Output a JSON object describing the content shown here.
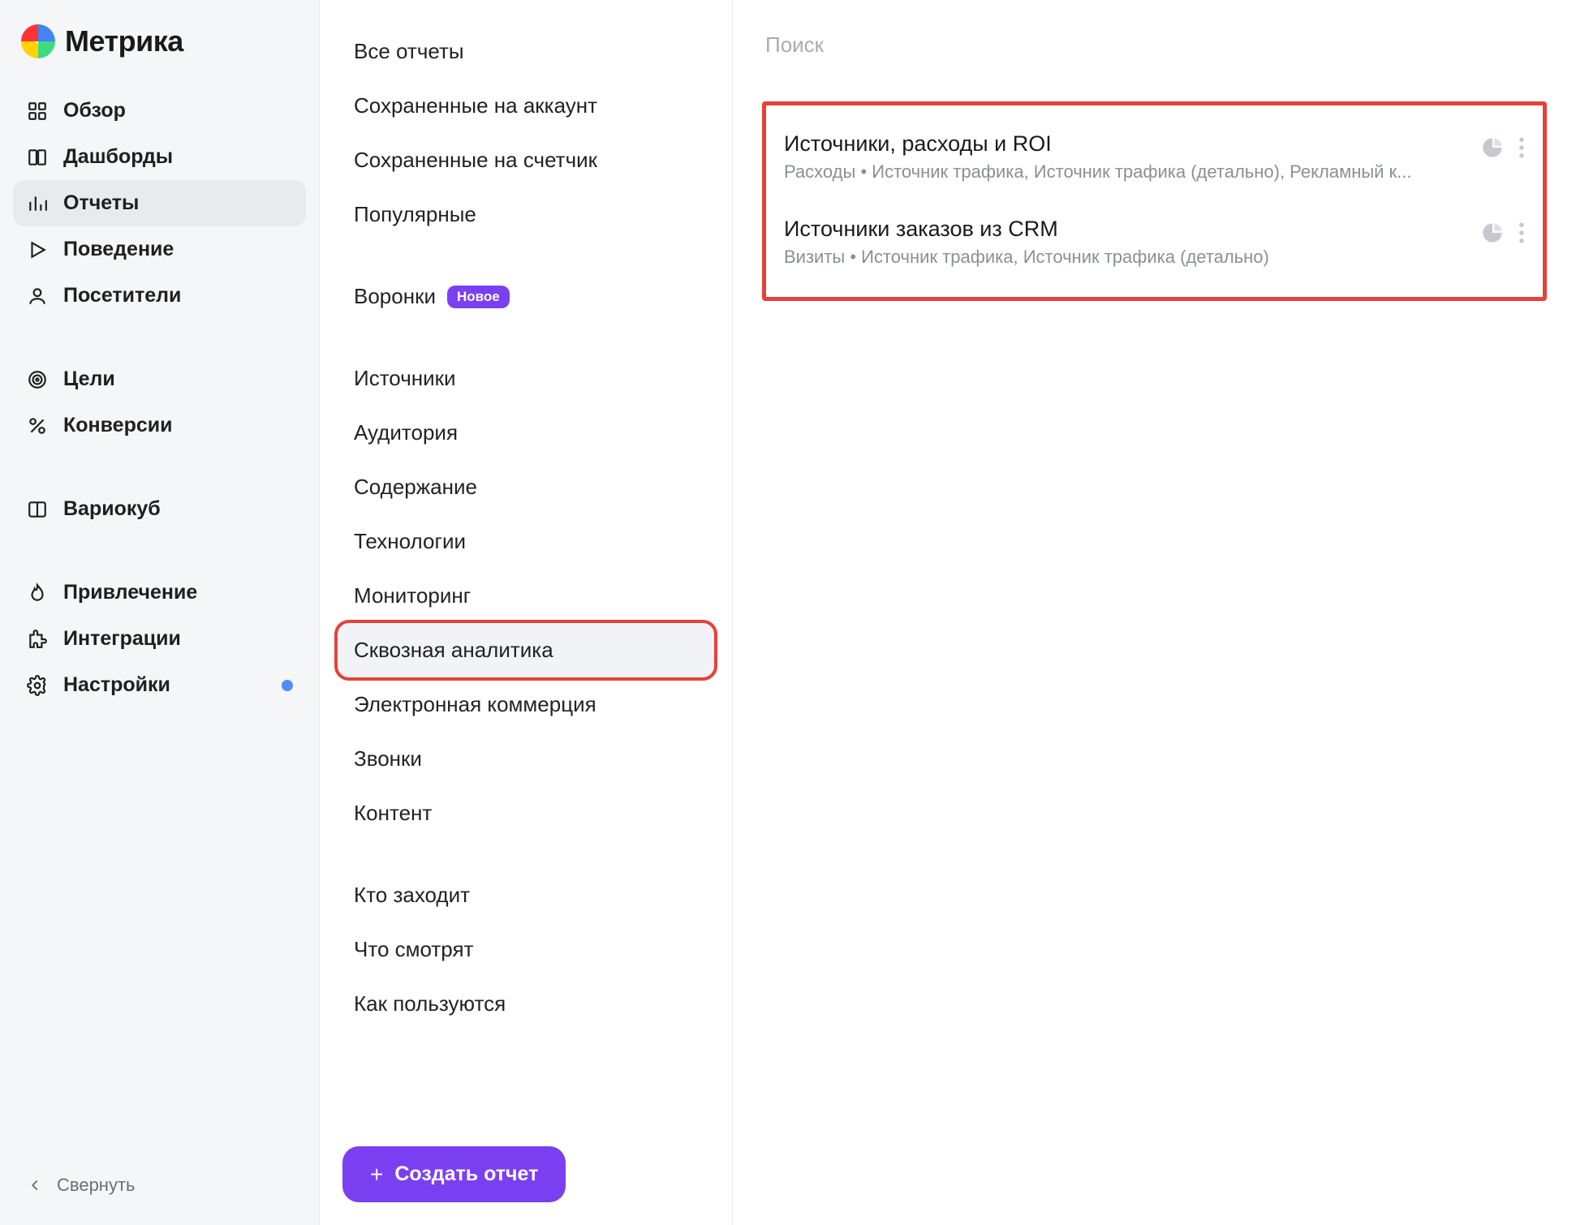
{
  "brand": {
    "name": "Метрика"
  },
  "sidebar": {
    "items": [
      {
        "id": "overview",
        "label": "Обзор"
      },
      {
        "id": "dashboards",
        "label": "Дашборды"
      },
      {
        "id": "reports",
        "label": "Отчеты"
      },
      {
        "id": "behavior",
        "label": "Поведение"
      },
      {
        "id": "visitors",
        "label": "Посетители"
      },
      {
        "id": "goals",
        "label": "Цели"
      },
      {
        "id": "conversions",
        "label": "Конверсии"
      },
      {
        "id": "variokub",
        "label": "Вариокуб"
      },
      {
        "id": "acquisition",
        "label": "Привлечение"
      },
      {
        "id": "integrations",
        "label": "Интеграции"
      },
      {
        "id": "settings",
        "label": "Настройки"
      }
    ],
    "collapse": "Свернуть"
  },
  "categories": {
    "items": [
      {
        "id": "all",
        "label": "Все отчеты"
      },
      {
        "id": "saved_acct",
        "label": "Сохраненные на аккаунт"
      },
      {
        "id": "saved_cnt",
        "label": "Сохраненные на счетчик"
      },
      {
        "id": "popular",
        "label": "Популярные"
      },
      {
        "id": "funnels",
        "label": "Воронки",
        "badge": "Новое"
      },
      {
        "id": "sources",
        "label": "Источники"
      },
      {
        "id": "audience",
        "label": "Аудитория"
      },
      {
        "id": "content",
        "label": "Содержание"
      },
      {
        "id": "tech",
        "label": "Технологии"
      },
      {
        "id": "monitoring",
        "label": "Мониторинг"
      },
      {
        "id": "endtoend",
        "label": "Сквозная аналитика"
      },
      {
        "id": "ecommerce",
        "label": "Электронная коммерция"
      },
      {
        "id": "calls",
        "label": "Звонки"
      },
      {
        "id": "content2",
        "label": "Контент"
      },
      {
        "id": "who",
        "label": "Кто заходит"
      },
      {
        "id": "what",
        "label": "Что смотрят"
      },
      {
        "id": "how",
        "label": "Как пользуются"
      }
    ],
    "create": "Создать отчет"
  },
  "main": {
    "search_placeholder": "Поиск",
    "reports": [
      {
        "title": "Источники, расходы и ROI",
        "subtitle": "Расходы • Источник трафика, Источник трафика (детально), Рекламный к..."
      },
      {
        "title": "Источники заказов из CRM",
        "subtitle": "Визиты • Источник трафика, Источник трафика (детально)"
      }
    ]
  }
}
